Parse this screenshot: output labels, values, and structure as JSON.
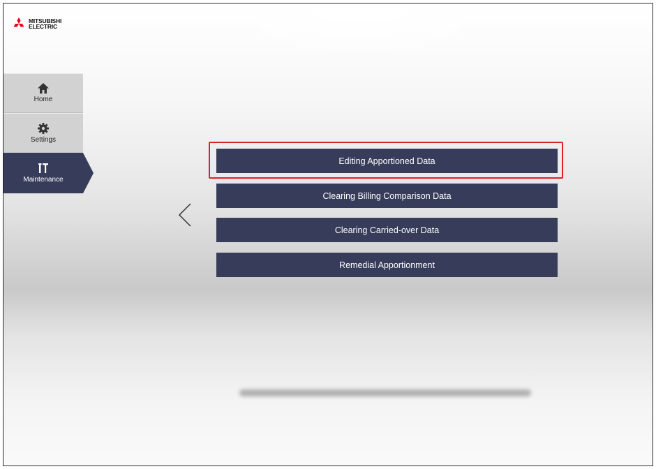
{
  "logo": {
    "line1": "MITSUBISHI",
    "line2": "ELECTRIC",
    "color": "#e60012"
  },
  "sidebar": {
    "items": [
      {
        "label": "Home",
        "icon": "home-icon",
        "active": false
      },
      {
        "label": "Settings",
        "icon": "gear-icon",
        "active": false
      },
      {
        "label": "Maintenance",
        "icon": "tools-icon",
        "active": true
      }
    ]
  },
  "menu": {
    "items": [
      {
        "label": "Editing Apportioned Data",
        "highlighted": true
      },
      {
        "label": "Clearing Billing Comparison Data"
      },
      {
        "label": "Clearing Carried-over Data"
      },
      {
        "label": "Remedial Apportionment"
      }
    ]
  },
  "colors": {
    "nav_active": "#363c59",
    "button_bg": "#363c59",
    "highlight": "#d8232a",
    "nav_inactive": "#d2d2d2"
  }
}
